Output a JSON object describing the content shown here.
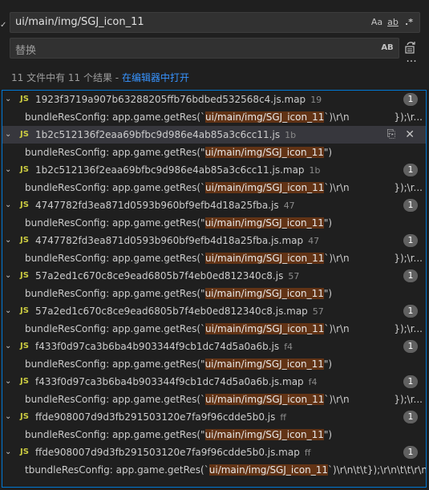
{
  "search": {
    "query": "ui/main/img/SGJ_icon_11",
    "replace_placeholder": "替换",
    "match_case_label": "Aa",
    "whole_word_label": "ab",
    "regex_label": ".*",
    "preserve_case_label": "AB"
  },
  "summary": {
    "text": "11 文件中有 11 个结果 - ",
    "link": "在编辑器中打开"
  },
  "results": [
    {
      "file": "1923f3719a907b63288205ffb76bdbed532568c4.js.map",
      "dir": "19",
      "count": "1",
      "prefix": "bundleResConfig: app.game.getRes(`",
      "match": "ui/main/img/SGJ_icon_11",
      "suffix": "`)\\r\\n",
      "tail": "});\\r..."
    },
    {
      "file": "1b2c512136f2eaa69bfbc9d986e4ab85a3c6cc11.js",
      "dir": "1b",
      "count": "",
      "active": true,
      "prefix": "bundleResConfig: app.game.getRes(\"",
      "match": "ui/main/img/SGJ_icon_11",
      "suffix": "\")",
      "tail": ""
    },
    {
      "file": "1b2c512136f2eaa69bfbc9d986e4ab85a3c6cc11.js.map",
      "dir": "1b",
      "count": "1",
      "prefix": "bundleResConfig: app.game.getRes(`",
      "match": "ui/main/img/SGJ_icon_11",
      "suffix": "`)\\r\\n",
      "tail": "});\\r..."
    },
    {
      "file": "4747782fd3ea871d0593b960bf9efb4d18a25fba.js",
      "dir": "47",
      "count": "1",
      "prefix": "bundleResConfig: app.game.getRes(\"",
      "match": "ui/main/img/SGJ_icon_11",
      "suffix": "\")",
      "tail": ""
    },
    {
      "file": "4747782fd3ea871d0593b960bf9efb4d18a25fba.js.map",
      "dir": "47",
      "count": "1",
      "prefix": "bundleResConfig: app.game.getRes(`",
      "match": "ui/main/img/SGJ_icon_11",
      "suffix": "`)\\r\\n",
      "tail": "});\\r..."
    },
    {
      "file": "57a2ed1c670c8ce9ead6805b7f4eb0ed812340c8.js",
      "dir": "57",
      "count": "1",
      "prefix": "bundleResConfig: app.game.getRes(\"",
      "match": "ui/main/img/SGJ_icon_11",
      "suffix": "\")",
      "tail": ""
    },
    {
      "file": "57a2ed1c670c8ce9ead6805b7f4eb0ed812340c8.js.map",
      "dir": "57",
      "count": "1",
      "prefix": "bundleResConfig: app.game.getRes(`",
      "match": "ui/main/img/SGJ_icon_11",
      "suffix": "`)\\r\\n",
      "tail": "});\\r..."
    },
    {
      "file": "f433f0d97ca3b6ba4b903344f9cb1dc74d5a0a6b.js",
      "dir": "f4",
      "count": "1",
      "prefix": "bundleResConfig: app.game.getRes(\"",
      "match": "ui/main/img/SGJ_icon_11",
      "suffix": "\")",
      "tail": ""
    },
    {
      "file": "f433f0d97ca3b6ba4b903344f9cb1dc74d5a0a6b.js.map",
      "dir": "f4",
      "count": "1",
      "prefix": "bundleResConfig: app.game.getRes(`",
      "match": "ui/main/img/SGJ_icon_11",
      "suffix": "`)\\r\\n",
      "tail": "});\\r..."
    },
    {
      "file": "ffde908007d9d3fb291503120e7fa9f96cdde5b0.js",
      "dir": "ff",
      "count": "1",
      "prefix": "bundleResConfig: app.game.getRes(\"",
      "match": "ui/main/img/SGJ_icon_11",
      "suffix": "\")",
      "tail": ""
    },
    {
      "file": "ffde908007d9d3fb291503120e7fa9f96cdde5b0.js.map",
      "dir": "ff",
      "count": "1",
      "prefix": "tbundleResConfig: app.game.getRes(`",
      "match": "ui/main/img/SGJ_icon_11",
      "suffix": "`)\\r\\n\\t\\t});\\r\\n\\t\\t\\r\\n...",
      "tail": ""
    }
  ],
  "colors": {
    "background": "#1f1f1f",
    "match_highlight": "#623315",
    "js_icon": "#cbcb41",
    "link": "#3794ff",
    "focus_border": "#0078d4"
  }
}
